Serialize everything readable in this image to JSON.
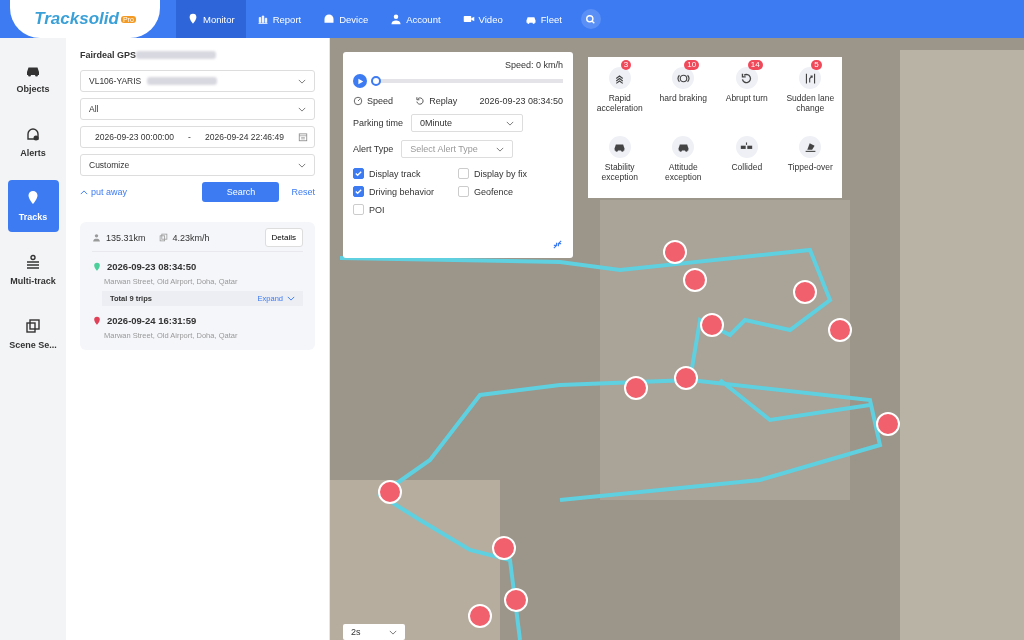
{
  "header": {
    "logo": "Tracksolid",
    "logo_badge": "Pro",
    "nav": [
      {
        "label": "Monitor",
        "selected": true
      },
      {
        "label": "Report",
        "selected": false
      },
      {
        "label": "Device",
        "selected": false
      },
      {
        "label": "Account",
        "selected": false
      },
      {
        "label": "Video",
        "selected": false
      },
      {
        "label": "Fleet",
        "selected": false
      }
    ]
  },
  "rail": [
    {
      "label": "Objects",
      "selected": false
    },
    {
      "label": "Alerts",
      "selected": false
    },
    {
      "label": "Tracks",
      "selected": true
    },
    {
      "label": "Multi-track",
      "selected": false
    },
    {
      "label": "Scene Se...",
      "selected": false
    }
  ],
  "panel": {
    "account": "Fairdeal GPS",
    "device": "VL106-YARIS",
    "filter": "All",
    "start": "2026-09-23 00:00:00",
    "separator": "-",
    "end": "2026-09-24 22:46:49",
    "range": "Customize",
    "collapse": "put away",
    "search": "Search",
    "reset": "Reset",
    "summary": {
      "distance": "135.31km",
      "speed": "4.23km/h",
      "details": "Details",
      "start_time": "2026-09-23 08:34:50",
      "start_address": "Marwan Street, Old Airport, Doha, Qatar",
      "trips": "Total 9 trips",
      "expand": "Expand",
      "end_time": "2026-09-24 16:31:59",
      "end_address": "Marwan Street, Old Airport, Doha, Qatar"
    }
  },
  "playback": {
    "speed_reading": "Speed: 0 km/h",
    "level": 0,
    "speed": "Speed",
    "replay": "Replay",
    "time": "2026-09-23 08:34:50",
    "parking_label": "Parking time",
    "parking_value": "0Minute",
    "alert_label": "Alert Type",
    "alert_placeholder": "Select Alert Type",
    "options": [
      {
        "label": "Display track",
        "checked": true
      },
      {
        "label": "Display by fix",
        "checked": false
      },
      {
        "label": "Driving behavior",
        "checked": true
      },
      {
        "label": "Geofence",
        "checked": false
      },
      {
        "label": "POI",
        "checked": false
      }
    ]
  },
  "alerts": [
    {
      "label": "Rapid acceleration",
      "count": "3"
    },
    {
      "label": "hard braking",
      "count": "10"
    },
    {
      "label": "Abrupt turn",
      "count": "14"
    },
    {
      "label": "Sudden lane change",
      "count": "5"
    },
    {
      "label": "Stability exception"
    },
    {
      "label": "Attitude exception"
    },
    {
      "label": "Collided"
    },
    {
      "label": "Tipped-over"
    }
  ],
  "playback_interval": "2s"
}
